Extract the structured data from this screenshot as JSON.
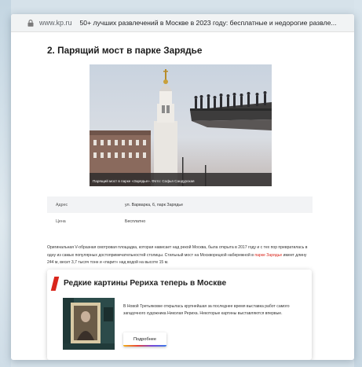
{
  "browser": {
    "url": "www.kp.ru",
    "page_title": "50+ лучших развлечений в Москве в 2023 году: бесплатные и недорогие развле..."
  },
  "article": {
    "heading": "2. Парящий мост в парке Зарядье",
    "photo_caption": "Парящий мост в парке «Зарядье». Фото: Софья Сандурская",
    "info": [
      {
        "key": "Адрес",
        "value": "ул. Варварка, 6, парк Зарядье"
      },
      {
        "key": "Цена",
        "value": "Бесплатно"
      }
    ],
    "desc_part1": "Оригинальная V-образная смотровая площадка, которая нависает над рекой Москва, была открыта в 2017 году и с тех пор превратилась в одну из самых популярных достопримечательностей столицы. Стильный мост на Москворецкой набережной в ",
    "desc_link": "парке Зарядье",
    "desc_part2": " имеет длину 244 м, весит 3,7 тысяч тонн и «парит» над водой на высоте 15 м."
  },
  "related_card": {
    "title": "Редкие картины Рериха теперь в Москве",
    "text": "В Новой Третьяковке открылась крупнейшая за последнее время выставка работ самого загадочного художника Николая Рериха. Некоторые картины выставляются впервые.",
    "button_label": "Подробнее"
  },
  "colors": {
    "accent_red": "#d9261c",
    "link_red": "#d9261c"
  },
  "icons": {
    "lock": "lock-icon"
  }
}
